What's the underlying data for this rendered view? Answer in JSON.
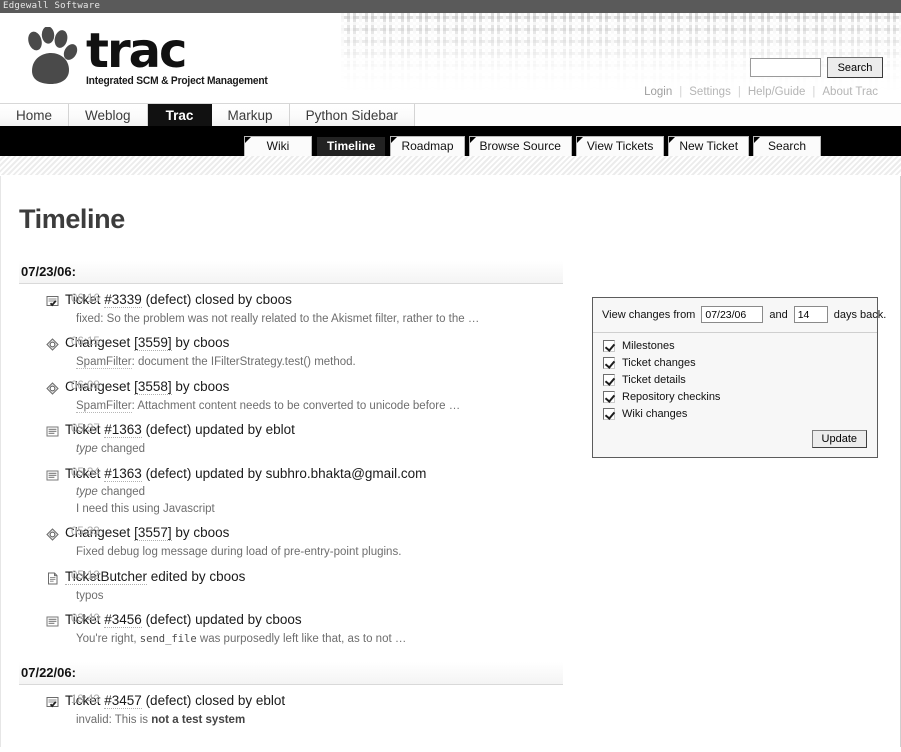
{
  "window": {
    "title": "Edgewall Software"
  },
  "brand": {
    "name": "trac",
    "tagline": "Integrated SCM & Project Management",
    "paw_icon": "paw-print-icon"
  },
  "search": {
    "value": "",
    "placeholder": "",
    "button_label": "Search"
  },
  "metanav": {
    "items": [
      {
        "label": "Login"
      },
      {
        "label": "Settings"
      },
      {
        "label": "Help/Guide"
      },
      {
        "label": "About Trac"
      }
    ],
    "separator": "|"
  },
  "sitetabs": {
    "items": [
      {
        "label": "Home",
        "active": false
      },
      {
        "label": "Weblog",
        "active": false
      },
      {
        "label": "Trac",
        "active": true
      },
      {
        "label": "Markup",
        "active": false
      },
      {
        "label": "Python Sidebar",
        "active": false
      }
    ]
  },
  "mainnav": {
    "items": [
      {
        "label": "Wiki",
        "active": false
      },
      {
        "label": "Timeline",
        "active": true
      },
      {
        "label": "Roadmap",
        "active": false
      },
      {
        "label": "Browse Source",
        "active": false
      },
      {
        "label": "View Tickets",
        "active": false
      },
      {
        "label": "New Ticket",
        "active": false
      },
      {
        "label": "Search",
        "active": false
      }
    ]
  },
  "page": {
    "title": "Timeline"
  },
  "prefs": {
    "label_from": "View changes from",
    "from_value": "07/23/06",
    "label_and": "and",
    "days_value": "14",
    "label_daysback": "days back.",
    "checkboxes": [
      {
        "label": "Milestones",
        "checked": true
      },
      {
        "label": "Ticket changes",
        "checked": true
      },
      {
        "label": "Ticket details",
        "checked": true
      },
      {
        "label": "Repository checkins",
        "checked": true
      },
      {
        "label": "Wiki changes",
        "checked": true
      }
    ],
    "update_label": "Update"
  },
  "timeline": {
    "days": [
      {
        "date": "07/23/06:",
        "events": [
          {
            "icon": "ticket-closed-icon",
            "time": "06:16",
            "title_pre": "Ticket ",
            "link": "#3339",
            "title_post": " (defect) closed by cboos",
            "desc": "fixed: So the problem was not really related to the Akismet filter, rather to the …"
          },
          {
            "icon": "changeset-icon",
            "time": "06:15",
            "title_pre": "Changeset ",
            "link": "[3559]",
            "title_post": " by cboos",
            "desc_link": "SpamFilter",
            "desc": ": document the IFilterStrategy.test() method."
          },
          {
            "icon": "changeset-icon",
            "time": "06:08",
            "title_pre": "Changeset ",
            "link": "[3558]",
            "title_post": " by cboos",
            "desc_link": "SpamFilter",
            "desc": ": Attachment content needs to be converted to unicode before …"
          },
          {
            "icon": "ticket-updated-icon",
            "time": "05:37",
            "title_pre": "Ticket ",
            "link": "#1363",
            "title_post": " (defect) updated by eblot",
            "desc_em": "type",
            "desc": " changed"
          },
          {
            "icon": "ticket-updated-icon",
            "time": "05:34",
            "title_pre": "Ticket ",
            "link": "#1363",
            "title_post": " (defect) updated by subhro.bhakta@gmail.com",
            "desc_em": "type",
            "desc": " changed",
            "desc_line2": "I need this using Javascript"
          },
          {
            "icon": "changeset-icon",
            "time": "05:33",
            "title_pre": "Changeset ",
            "link": "[3557]",
            "title_post": " by cboos",
            "desc": "Fixed debug log message during load of pre-entry-point plugins."
          },
          {
            "icon": "wiki-page-icon",
            "time": "05:12",
            "title_pre": "",
            "link": "TicketButcher",
            "title_post": " edited by cboos",
            "desc": "typos"
          },
          {
            "icon": "ticket-updated-icon",
            "time": "03:40",
            "title_pre": "Ticket ",
            "link": "#3456",
            "title_post": " (defect) updated by cboos",
            "desc_pre": "You're right, ",
            "desc_code": "send_file",
            "desc": " was purposedly left like that, as to not …"
          }
        ]
      },
      {
        "date": "07/22/06:",
        "events": [
          {
            "icon": "ticket-closed-icon",
            "time": "18:43",
            "title_pre": "Ticket ",
            "link": "#3457",
            "title_post": " (defect) closed by eblot",
            "desc_pre": "invalid: This is ",
            "desc_bold": "not a test system",
            "desc": ""
          }
        ]
      }
    ]
  },
  "colors": {
    "nav_active_bg": "#222222",
    "tab_active_bg": "#111111",
    "page_title": "#3c3c3c",
    "muted_text": "#6e6e6e",
    "time_text": "#a9a9a9"
  }
}
